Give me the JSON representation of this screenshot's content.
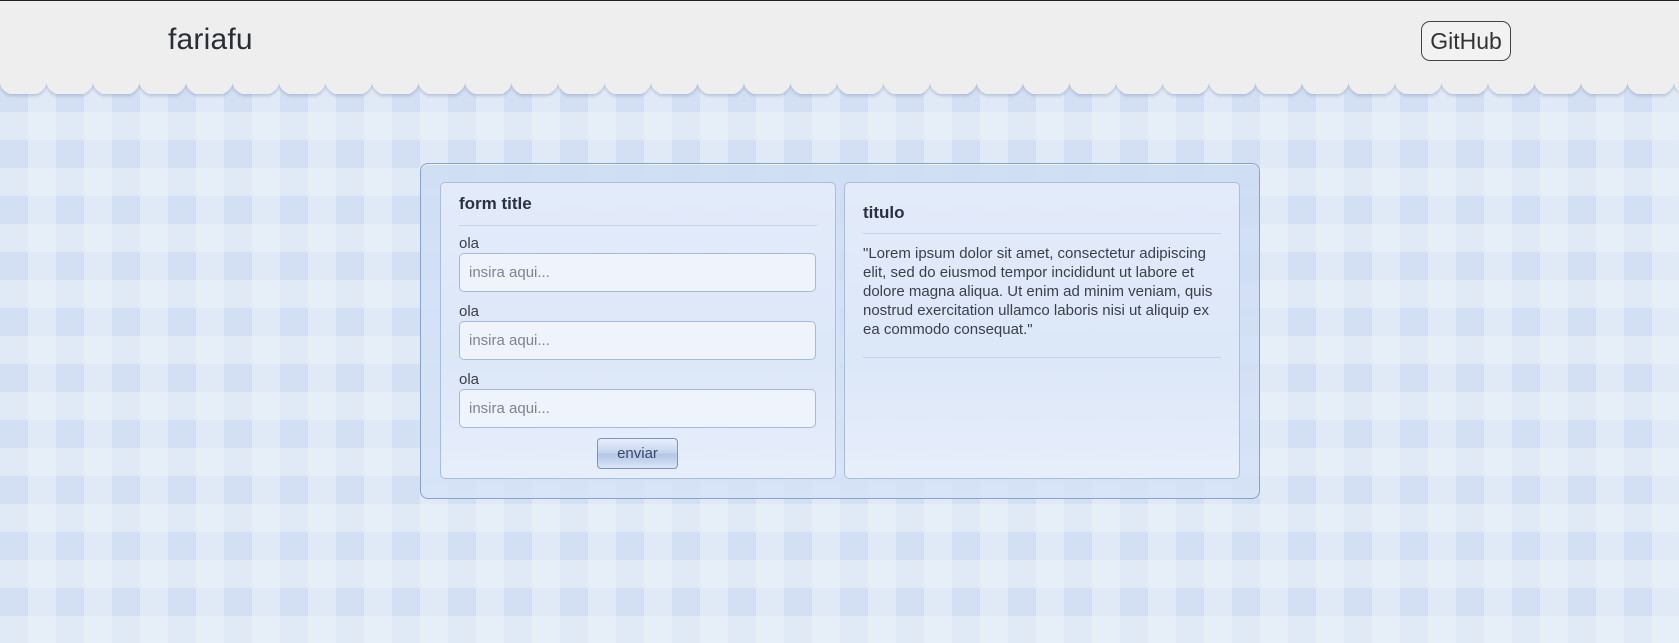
{
  "header": {
    "brand": "fariafu",
    "github_label": "GitHub"
  },
  "form_card": {
    "title": "form title",
    "fields": [
      {
        "label": "ola",
        "placeholder": "insira aqui..."
      },
      {
        "label": "ola",
        "placeholder": "insira aqui..."
      },
      {
        "label": "ola",
        "placeholder": "insira aqui..."
      }
    ],
    "submit_label": "enviar"
  },
  "text_card": {
    "title": "titulo",
    "body": "\"Lorem ipsum dolor sit amet, consectetur adipiscing elit, sed do eiusmod tempor incididunt ut labore et dolore magna aliqua. Ut enim ad minim veniam, quis nostrud exercitation ullamco laboris nisi ut aliquip ex ea commodo consequat.\""
  },
  "colors": {
    "header_bg": "#eeeeee",
    "page_bg": "#d3dff3",
    "panel_border": "#8aa2c8"
  }
}
